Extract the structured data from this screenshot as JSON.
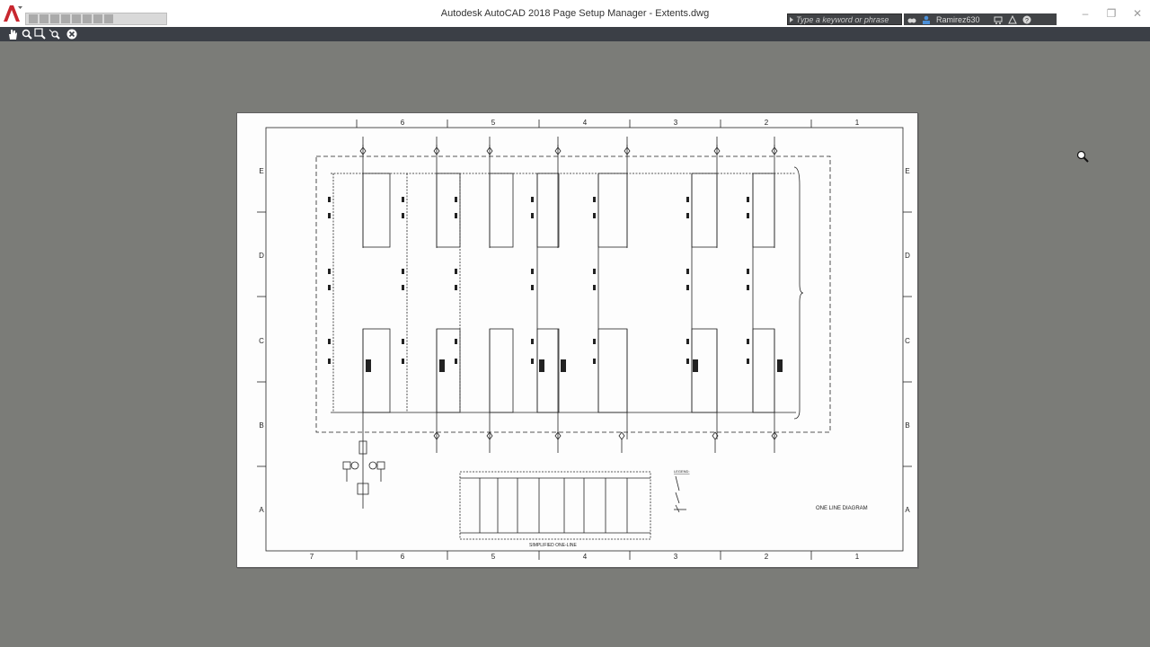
{
  "window": {
    "title": "Autodesk AutoCAD 2018   Page Setup Manager - Extents.dwg",
    "controls": [
      "minimize",
      "restore",
      "close"
    ]
  },
  "quick_access": [
    "new",
    "open",
    "save",
    "save-as",
    "plot",
    "undo",
    "redo",
    "workspace"
  ],
  "infocenter": {
    "search_placeholder": "Type a keyword or phrase",
    "user": "Ramirez630",
    "icons": [
      "binoculars-icon",
      "user-icon",
      "cart-icon",
      "exchange-icon",
      "help-icon"
    ]
  },
  "preview_toolbar": {
    "tools": [
      "pan-icon",
      "zoom-realtime-icon",
      "zoom-window-icon",
      "zoom-original-icon",
      "close-preview-icon"
    ]
  },
  "drawing": {
    "column_labels": [
      "7",
      "6",
      "5",
      "4",
      "3",
      "2",
      "1"
    ],
    "row_labels": [
      "E",
      "D",
      "C",
      "B",
      "A"
    ],
    "title_block": "ONE LINE DIAGRAM",
    "sub_caption": "SIMPLIFIED ONE-LINE",
    "legend_title": "LEGEND:"
  },
  "colors": {
    "canvas": "#7b7c78",
    "titlebar": "#ffffff",
    "toolbar": "#3b3f46",
    "sheet": "#fdfdfd",
    "logo_red": "#c8272f"
  }
}
